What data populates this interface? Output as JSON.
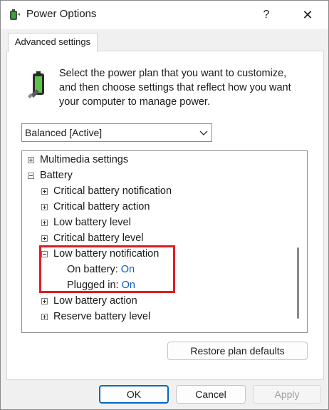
{
  "window": {
    "title": "Power Options",
    "help_glyph": "?",
    "close_glyph": "✕"
  },
  "tab": {
    "label": "Advanced settings"
  },
  "description": "Select the power plan that you want to customize, and then choose settings that reflect how you want your computer to manage power.",
  "plan_select": {
    "value": "Balanced [Active]"
  },
  "tree": {
    "multimedia": "Multimedia settings",
    "battery": "Battery",
    "critical_notification": "Critical battery notification",
    "critical_action": "Critical battery action",
    "low_level": "Low battery level",
    "critical_level": "Critical battery level",
    "low_notification": "Low battery notification",
    "on_battery_label": "On battery:",
    "on_battery_value": "On",
    "plugged_in_label": "Plugged in:",
    "plugged_in_value": "On",
    "low_action": "Low battery action",
    "reserve_level": "Reserve battery level"
  },
  "buttons": {
    "restore": "Restore plan defaults",
    "ok": "OK",
    "cancel": "Cancel",
    "apply": "Apply"
  },
  "colors": {
    "highlight": "#e01b24",
    "value_link": "#0a5bc4",
    "ok_border": "#0067c0"
  }
}
